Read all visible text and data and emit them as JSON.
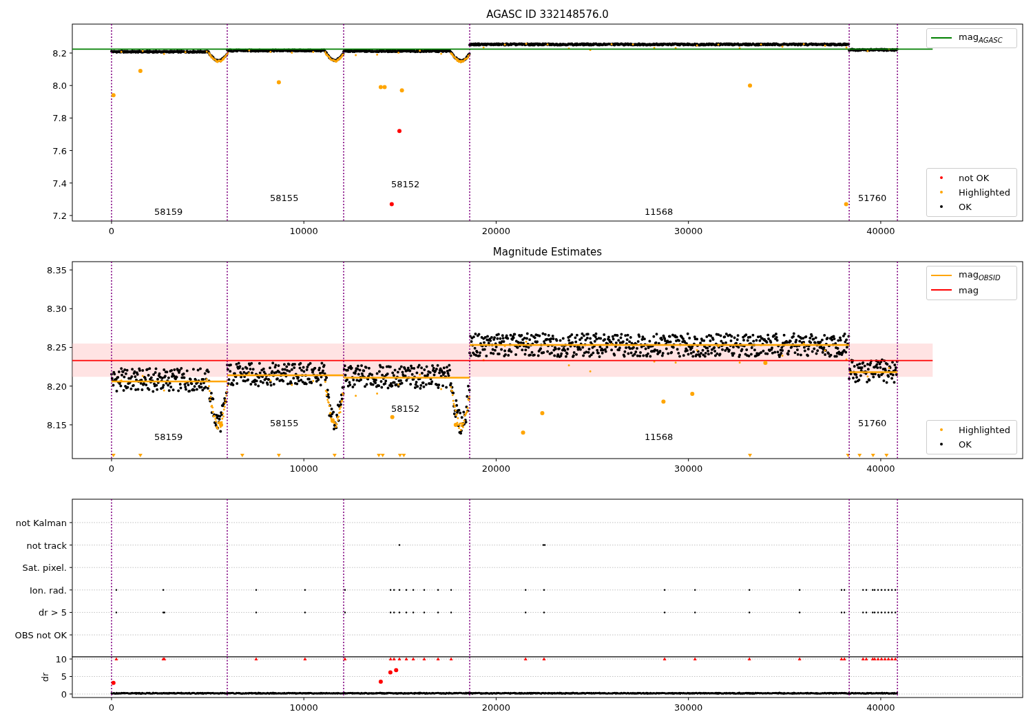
{
  "panels": [
    {
      "chart_data": {
        "type": "scatter",
        "title": "AGASC ID 332148576.0",
        "xlim": [
          -2040,
          47380
        ],
        "ylim": [
          7.166,
          8.378
        ],
        "xticks": [
          {
            "value": 0,
            "label": "0"
          },
          {
            "value": 10000,
            "label": "10000"
          },
          {
            "value": 20000,
            "label": "20000"
          },
          {
            "value": 30000,
            "label": "30000"
          },
          {
            "value": 40000,
            "label": "40000"
          }
        ],
        "yticks": [
          {
            "value": 7.2,
            "label": "7.2"
          },
          {
            "value": 7.4,
            "label": "7.4"
          },
          {
            "value": 7.6,
            "label": "7.6"
          },
          {
            "value": 7.8,
            "label": "7.8"
          },
          {
            "value": 8.0,
            "label": "8.0"
          },
          {
            "value": 8.2,
            "label": "8.2"
          }
        ],
        "series": [
          {
            "name": "mag$_{AGASC}$",
            "type": "line",
            "color": "#008000",
            "x": [
              -2040,
              42700
            ],
            "values": [
              8.224,
              8.224
            ]
          },
          {
            "name": "not OK",
            "type": "scatter",
            "color": "#ff0000",
            "x": [
              14970,
              14570
            ],
            "values": [
              7.72,
              7.27
            ]
          },
          {
            "name": "Highlighted",
            "type": "scatter",
            "color": "#ffa500",
            "x": [
              100,
              1500,
              14000,
              14200,
              15100,
              33200,
              38200,
              8700
            ],
            "values": [
              7.94,
              8.09,
              7.99,
              7.99,
              7.97,
              8.0,
              7.27,
              8.02
            ]
          },
          {
            "name": "OK",
            "type": "scatter",
            "color": "#000000"
          }
        ],
        "legend": "upper right",
        "annotations": [
          "58159",
          "58155",
          "58152",
          "11568",
          "51760"
        ]
      }
    },
    {
      "chart_data": {
        "type": "scatter",
        "title": "Magnitude Estimates",
        "xlim": [
          -2040,
          47380
        ],
        "ylim": [
          8.1064,
          8.3607
        ],
        "xticks": [
          {
            "value": 0,
            "label": "0"
          },
          {
            "value": 10000,
            "label": "10000"
          },
          {
            "value": 20000,
            "label": "20000"
          },
          {
            "value": 30000,
            "label": "30000"
          },
          {
            "value": 40000,
            "label": "40000"
          }
        ],
        "yticks": [
          {
            "value": 8.15,
            "label": "8.15"
          },
          {
            "value": 8.2,
            "label": "8.20"
          },
          {
            "value": 8.25,
            "label": "8.25"
          },
          {
            "value": 8.3,
            "label": "8.30"
          },
          {
            "value": 8.35,
            "label": "8.35"
          }
        ],
        "series": [
          {
            "name": "mag$_{OBSID}$",
            "type": "line",
            "color": "#ffa500",
            "x": [
              0,
              6017,
              null,
              6017,
              12070,
              null,
              12070,
              18625,
              null,
              18625,
              38360,
              null,
              38360,
              40867
            ],
            "values": [
              8.206,
              8.206,
              null,
              8.214,
              8.214,
              null,
              8.211,
              8.211,
              null,
              8.253,
              8.253,
              null,
              8.218,
              8.218
            ]
          },
          {
            "name": "mag",
            "type": "line",
            "color": "#ff0000",
            "x": [
              -2040,
              42700
            ],
            "values": [
              8.233,
              8.233
            ]
          },
          {
            "name": "Highlighted",
            "type": "scatter",
            "color": "#ffa500",
            "x": [
              21400,
              22400,
              28700,
              30200,
              34000,
              14600,
              5700,
              11500,
              17900
            ],
            "values": [
              8.14,
              8.165,
              8.18,
              8.19,
              8.23,
              8.16,
              8.15,
              8.155,
              8.15
            ]
          },
          {
            "name": "OK",
            "type": "scatter",
            "color": "#000000"
          }
        ],
        "legend": "upper right",
        "annotations": [
          "58159",
          "58155",
          "58152",
          "11568",
          "51760"
        ]
      }
    },
    {
      "flag_rows": [
        {
          "label": "not Kalman"
        },
        {
          "label": "not track"
        },
        {
          "label": "Sat. pixel."
        },
        {
          "label": "Ion. rad."
        },
        {
          "label": "dr > 5"
        },
        {
          "label": "OBS not OK"
        }
      ]
    },
    {
      "chart_data": {
        "type": "scatter",
        "ylabel": "dr",
        "grid": true,
        "xlim": [
          -2040,
          47380
        ],
        "ylim": [
          -1,
          10.6
        ],
        "xticks": [
          {
            "value": 0,
            "label": "0"
          },
          {
            "value": 10000,
            "label": "10000"
          },
          {
            "value": 20000,
            "label": "20000"
          },
          {
            "value": 30000,
            "label": "30000"
          },
          {
            "value": 40000,
            "label": "40000"
          }
        ],
        "yticks": [
          {
            "value": 0,
            "label": "0"
          },
          {
            "value": 5,
            "label": "5"
          },
          {
            "value": 10,
            "label": "10"
          }
        ],
        "series": [
          {
            "color": "#ff0000",
            "x": [
              250,
              2690,
              2750,
              7520,
              10060,
              12140,
              14510,
              14690,
              14970,
              15330,
              15690,
              16260,
              16980,
              17660,
              21530,
              22490,
              28760,
              30340,
              33170,
              35780,
              37960,
              38110,
              39080,
              39250,
              39580,
              39680,
              39860,
              40040,
              40220,
              40400,
              40580,
              40760,
              100,
              14000,
              14500,
              14800
            ],
            "values": [
              10,
              10,
              10,
              10,
              10,
              10,
              10,
              10,
              10,
              10,
              10,
              10,
              10,
              10,
              10,
              10,
              10,
              10,
              10,
              10,
              10,
              10,
              10,
              10,
              10,
              10,
              10,
              10,
              10,
              10,
              10,
              10,
              3.2,
              3.5,
              6.2,
              6.8
            ]
          }
        ]
      }
    }
  ]
}
